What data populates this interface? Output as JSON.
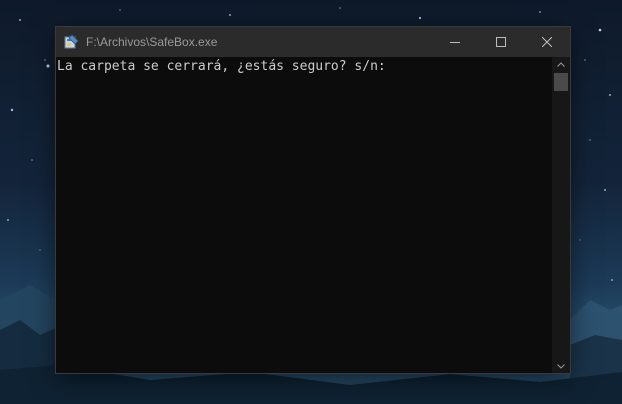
{
  "window": {
    "title": "F:\\Archivos\\SafeBox.exe",
    "app_icon": "safebox-app-icon",
    "controls": {
      "minimize_icon": "minimize-icon",
      "maximize_icon": "maximize-icon",
      "close_icon": "close-icon"
    }
  },
  "console": {
    "lines": [
      "La carpeta se cerrará, ¿estás seguro? s/n:"
    ]
  },
  "colors": {
    "titlebar_bg": "#2b2b2b",
    "console_bg": "#0c0c0c",
    "console_text": "#cccccc",
    "title_text": "#9a9a9a"
  }
}
